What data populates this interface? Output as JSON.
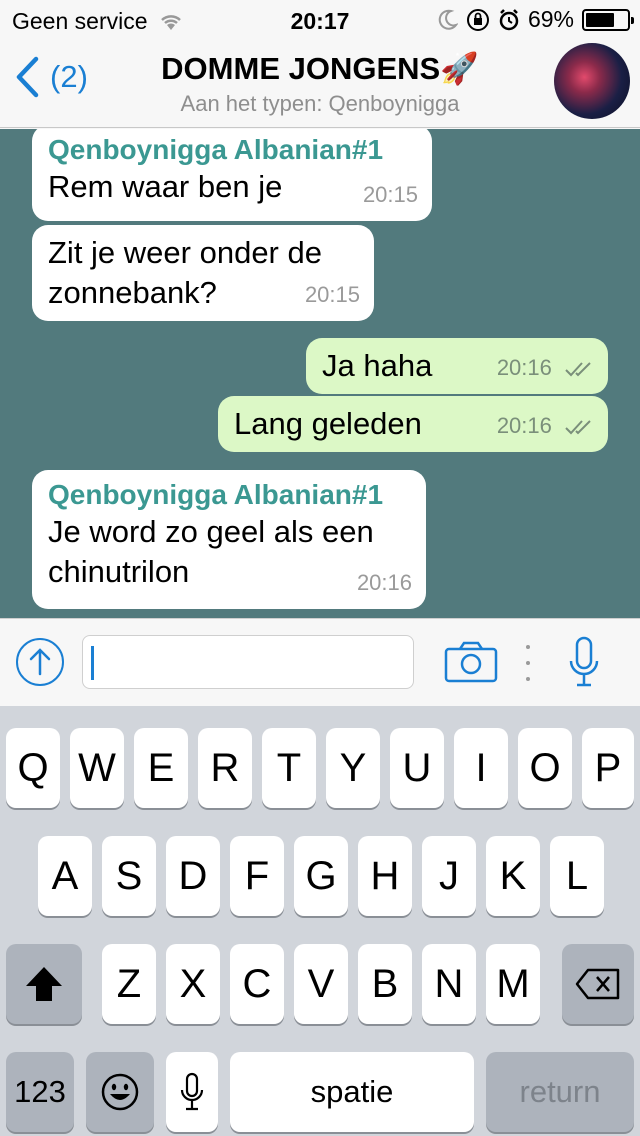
{
  "status_bar": {
    "carrier": "Geen service",
    "time": "20:17",
    "battery_percent": "69%",
    "battery_level": 0.69,
    "icons": [
      "wifi-icon",
      "moon-icon",
      "orientation-lock-icon",
      "alarm-icon"
    ]
  },
  "nav": {
    "back_count": "(2)",
    "title": "DOMME JONGENS🚀",
    "subtitle": "Aan het typen: Qenboynigga"
  },
  "messages": [
    {
      "direction": "in",
      "sender": "Qenboynigga Albanian#1",
      "text": "Rem waar ben je",
      "time": "20:15"
    },
    {
      "direction": "in",
      "sender": "",
      "text": "Zit je weer onder de zonnebank?",
      "time": "20:15"
    },
    {
      "direction": "out",
      "sender": "",
      "text": "Ja haha",
      "time": "20:16",
      "status": "read"
    },
    {
      "direction": "out",
      "sender": "",
      "text": "Lang geleden",
      "time": "20:16",
      "status": "read"
    },
    {
      "direction": "in",
      "sender": "Qenboynigga Albanian#1",
      "text": "Je word zo geel als een chinutrilon",
      "time": "20:16"
    }
  ],
  "input": {
    "value": ""
  },
  "keyboard": {
    "row1": [
      "Q",
      "W",
      "E",
      "R",
      "T",
      "Y",
      "U",
      "I",
      "O",
      "P"
    ],
    "row2": [
      "A",
      "S",
      "D",
      "F",
      "G",
      "H",
      "J",
      "K",
      "L"
    ],
    "row3": [
      "Z",
      "X",
      "C",
      "V",
      "B",
      "N",
      "M"
    ],
    "numbers_label": "123",
    "space_label": "spatie",
    "return_label": "return"
  },
  "colors": {
    "accent": "#1a7fd3",
    "chat_background": "#527a7d",
    "outgoing_bubble": "#dcf8c6",
    "incoming_bubble": "#ffffff",
    "sender_name": "#3b9892"
  }
}
